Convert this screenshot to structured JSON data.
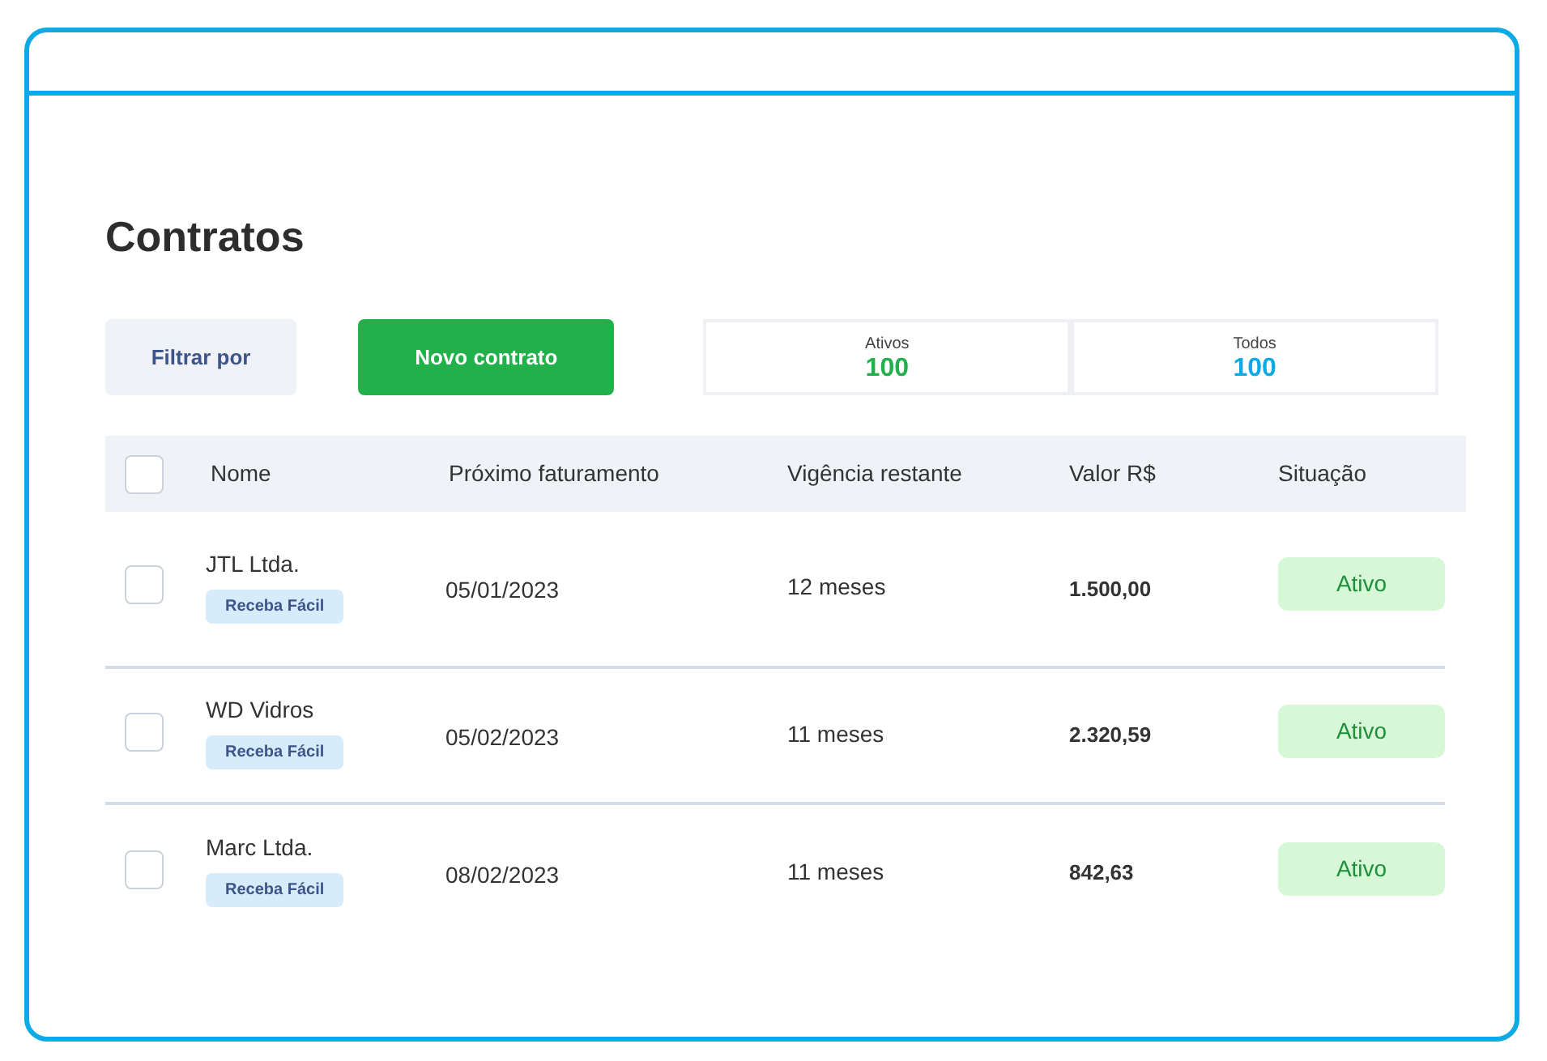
{
  "page": {
    "title": "Contratos"
  },
  "toolbar": {
    "filter_button": "Filtrar por",
    "new_button": "Novo contrato"
  },
  "stats": [
    {
      "label": "Ativos",
      "value": "100",
      "color": "#22b04b"
    },
    {
      "label": "Todos",
      "value": "100",
      "color": "#0fa9e6"
    }
  ],
  "table": {
    "select_all": {
      "checked": false
    },
    "columns": [
      "Nome",
      "Próximo faturamento",
      "Vigência restante",
      "Valor R$",
      "Situação"
    ],
    "rows": [
      {
        "checked": false,
        "name": "JTL Ltda.",
        "tag": "Receba Fácil",
        "next_billing": "05/01/2023",
        "remaining": "12 meses",
        "value": "1.500,00",
        "status": "Ativo"
      },
      {
        "checked": false,
        "name": "WD Vidros",
        "tag": "Receba Fácil",
        "next_billing": "05/02/2023",
        "remaining": "11 meses",
        "value": "2.320,59",
        "status": "Ativo"
      },
      {
        "checked": false,
        "name": "Marc Ltda.",
        "tag": "Receba Fácil",
        "next_billing": "08/02/2023",
        "remaining": "11 meses",
        "value": "842,63",
        "status": "Ativo"
      }
    ]
  }
}
